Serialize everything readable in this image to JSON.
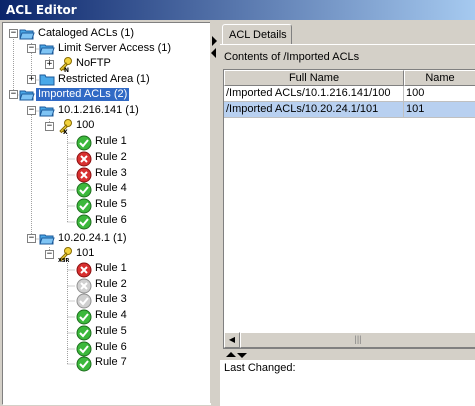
{
  "window": {
    "title": "ACL Editor"
  },
  "tree": {
    "cataloged": "Cataloged ACLs (1)",
    "limit_server": "Limit Server Access (1)",
    "noftp": "NoFTP",
    "restricted": "Restricted Area (1)",
    "imported": "Imported ACLs (2)",
    "ip1": "10.1.216.141 (1)",
    "acl100": "100",
    "rules_100": [
      "Rule 1",
      "Rule 2",
      "Rule 3",
      "Rule 4",
      "Rule 5",
      "Rule 6"
    ],
    "ip2": "10.20.24.1 (1)",
    "acl101": "101",
    "rules_101": [
      "Rule 1",
      "Rule 2",
      "Rule 3",
      "Rule 4",
      "Rule 5",
      "Rule 6",
      "Rule 7"
    ]
  },
  "tab": {
    "label": "ACL Details"
  },
  "details": {
    "contents_label": "Contents of /Imported ACLs",
    "columns": [
      "Full Name",
      "Name"
    ],
    "rows": [
      [
        "/Imported ACLs/10.1.216.141/100",
        "100"
      ],
      [
        "/Imported ACLs/10.20.24.1/101",
        "101"
      ]
    ],
    "last_changed_label": "Last Changed:"
  },
  "icons": {
    "folder": "folder-icon",
    "key": "key-icon",
    "rule_ok": "green-check-icon",
    "rule_deny": "red-x-icon",
    "rule_disabled": "gray-check-icon"
  },
  "colors": {
    "selection": "#316ac5",
    "row_selected": "#b8d0f0",
    "title_start": "#0a246a"
  }
}
